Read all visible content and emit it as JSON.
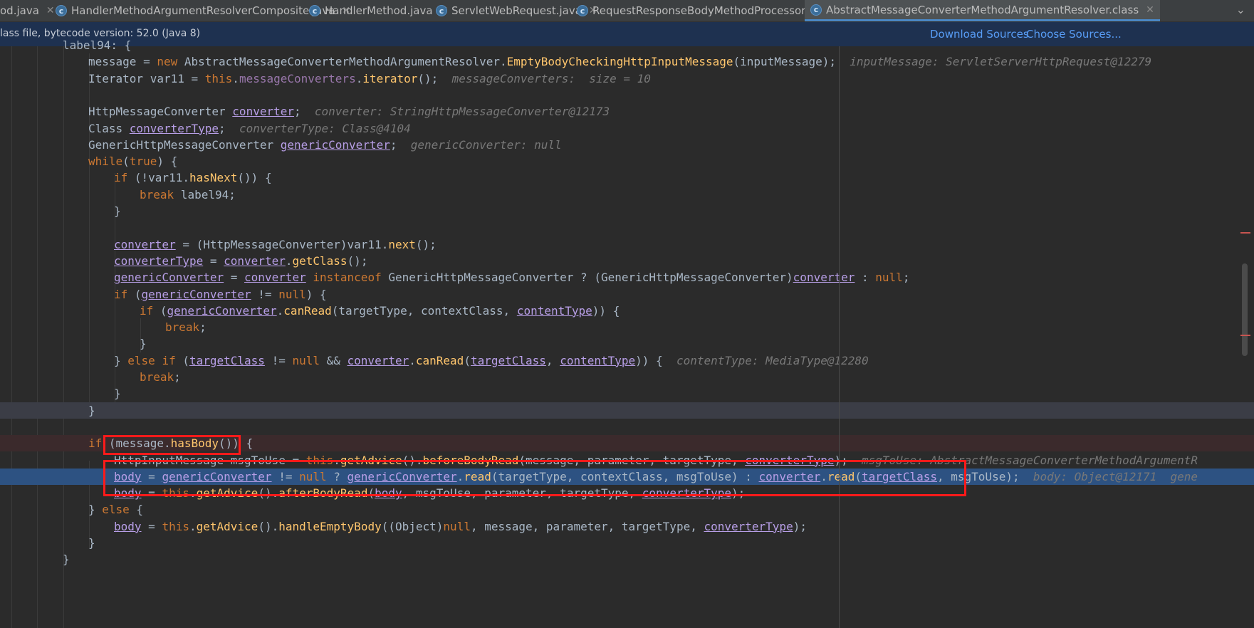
{
  "tabs": [
    {
      "label": "od.java",
      "icon": "java-class-icon"
    },
    {
      "label": "HandlerMethodArgumentResolverComposite.java",
      "icon": "java-class-icon"
    },
    {
      "label": "HandlerMethod.java",
      "icon": "java-class-icon"
    },
    {
      "label": "ServletWebRequest.java",
      "icon": "java-class-icon"
    },
    {
      "label": "RequestResponseBodyMethodProcessor.class",
      "icon": "java-class-icon"
    },
    {
      "label": "AbstractMessageConverterMethodArgumentResolver.class",
      "icon": "java-class-icon",
      "active": true
    }
  ],
  "close_glyph": "✕",
  "overflow_glyph": "⌄",
  "info_bar": {
    "message": "lass file, bytecode version: 52.0 (Java 8)",
    "download_sources": "Download Sources",
    "choose_sources": "Choose Sources..."
  },
  "code": [
    [
      "l1",
      "label94: {"
    ],
    [
      "l2",
      "message = new AbstractMessageConverterMethodArgumentResolver.EmptyBodyCheckingHttpInputMessage(inputMessage);"
    ],
    [
      "l2h",
      "inputMessage: ServletServerHttpRequest@12279"
    ],
    [
      "l3",
      "Iterator var11 = this.messageConverters.iterator();"
    ],
    [
      "l3h",
      "messageConverters:  size = 10"
    ],
    [
      "l5",
      "HttpMessageConverter converter;"
    ],
    [
      "l5h",
      "converter: StringHttpMessageConverter@12173"
    ],
    [
      "l6",
      "Class converterType;"
    ],
    [
      "l6h",
      "converterType: Class@4104"
    ],
    [
      "l7",
      "GenericHttpMessageConverter genericConverter;"
    ],
    [
      "l7h",
      "genericConverter: null"
    ],
    [
      "l8",
      "while(true) {"
    ],
    [
      "l9",
      "if (!var11.hasNext()) {"
    ],
    [
      "l10",
      "break label94;"
    ],
    [
      "l11",
      "}"
    ],
    [
      "l13",
      "converter = (HttpMessageConverter)var11.next();"
    ],
    [
      "l14",
      "converterType = converter.getClass();"
    ],
    [
      "l15",
      "genericConverter = converter instanceof GenericHttpMessageConverter ? (GenericHttpMessageConverter)converter : null;"
    ],
    [
      "l16",
      "if (genericConverter != null) {"
    ],
    [
      "l17",
      "if (genericConverter.canRead(targetType, contextClass, contentType)) {"
    ],
    [
      "l18",
      "break;"
    ],
    [
      "l19",
      "}"
    ],
    [
      "l20",
      "} else if (targetClass != null && converter.canRead(targetClass, contentType)) {"
    ],
    [
      "l20h",
      "contentType: MediaType@12280"
    ],
    [
      "l21",
      "break;"
    ],
    [
      "l22",
      "}"
    ],
    [
      "l23",
      "}"
    ],
    [
      "l25",
      "if (message.hasBody()) {"
    ],
    [
      "l26",
      "HttpInputMessage msgToUse = this.getAdvice().beforeBodyRead(message, parameter, targetType, converterType);"
    ],
    [
      "l26h",
      "msgToUse: AbstractMessageConverterMethodArgumentR"
    ],
    [
      "l27",
      "body = genericConverter != null ? genericConverter.read(targetType, contextClass, msgToUse) : converter.read(targetClass, msgToUse);"
    ],
    [
      "l27h",
      "body: Object@12171  gene"
    ],
    [
      "l28",
      "body = this.getAdvice().afterBodyRead(body, msgToUse, parameter, targetType, converterType);"
    ],
    [
      "l29",
      "} else {"
    ],
    [
      "l30",
      "body = this.getAdvice().handleEmptyBody((Object)null, message, parameter, targetType, converterType);"
    ],
    [
      "l31",
      "}"
    ],
    [
      "l32",
      "}"
    ]
  ]
}
